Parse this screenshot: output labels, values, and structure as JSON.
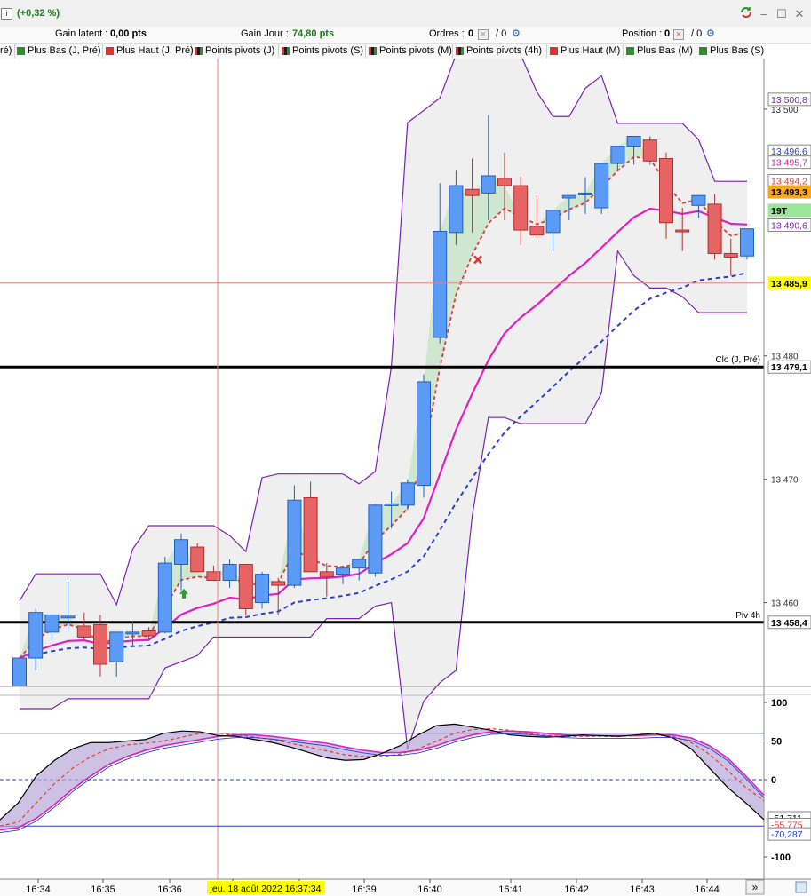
{
  "titlebar": {
    "change_pct": "(+0,32 %)",
    "info_glyph": "i"
  },
  "status": {
    "gain_latent_label": "Gain latent :",
    "gain_latent_value": "0,00 pts",
    "gain_jour_label": "Gain Jour :",
    "gain_jour_value": "74,80 pts",
    "ordres_label": "Ordres :",
    "ordres_value": "0",
    "ordres_slash": "/ 0",
    "position_label": "Position :",
    "position_value": "0",
    "position_slash": "/ 0"
  },
  "legend": [
    {
      "label": "ré)",
      "color": "none"
    },
    {
      "label": "Plus Bas (J, Pré)",
      "color": "#2e8b2e"
    },
    {
      "label": "Plus Haut (J, Pré)",
      "color": "#e03030"
    },
    {
      "label": "Points pivots (J)",
      "color": "#1a1a1a"
    },
    {
      "label": "Points pivots (S)",
      "color": "#1a1a1a"
    },
    {
      "label": "Points pivots (M)",
      "color": "#1a1a1a"
    },
    {
      "label": "Points pivots (4h)",
      "color": "#1a1a1a"
    },
    {
      "label": "Plus Haut (M)",
      "color": "#e03030"
    },
    {
      "label": "Plus Bas (M)",
      "color": "#2e8b2e"
    },
    {
      "label": "Plus Bas (S)",
      "color": "#2e8b2e"
    }
  ],
  "colors": {
    "bull": "#5b9bf5",
    "bear": "#e86464",
    "ema_fast": "#e03a3a",
    "ema_mid": "#e020c0",
    "ema_slow": "#2a3fd0",
    "bands": "#7a22b8",
    "crosshair": "#e88080"
  },
  "chart_data": [
    {
      "type": "candlestick",
      "x_ticks": [
        "16:34",
        "16:35",
        "16:36",
        "16:37",
        "16:38",
        "16:39",
        "16:40",
        "16:41",
        "16:42",
        "16:43",
        "16:44"
      ],
      "y_ticks": [
        13460,
        13470,
        13480,
        13500
      ],
      "y_tick_labels": [
        "13 460",
        "13 470",
        "13 480",
        "13 500"
      ],
      "ylim": [
        13453.2,
        13504.1
      ],
      "candles": [
        {
          "o": 13453.2,
          "h": 13454.5,
          "l": 13453.2,
          "c": 13455.5
        },
        {
          "o": 13455.5,
          "h": 13459.5,
          "l": 13454.5,
          "c": 13459.2
        },
        {
          "o": 13457.6,
          "h": 13458.5,
          "l": 13457.0,
          "c": 13459.0
        },
        {
          "o": 13458.9,
          "h": 13461.7,
          "l": 13457.6,
          "c": 13458.9
        },
        {
          "o": 13458.1,
          "h": 13459.2,
          "l": 13457.0,
          "c": 13457.2
        },
        {
          "o": 13458.2,
          "h": 13459.0,
          "l": 13454.0,
          "c": 13455.0
        },
        {
          "o": 13455.2,
          "h": 13456.5,
          "l": 13454.0,
          "c": 13457.6
        },
        {
          "o": 13457.6,
          "h": 13458.5,
          "l": 13456.5,
          "c": 13457.6
        },
        {
          "o": 13457.7,
          "h": 13458.0,
          "l": 13457.0,
          "c": 13457.3
        },
        {
          "o": 13457.6,
          "h": 13463.7,
          "l": 13457.5,
          "c": 13463.2
        },
        {
          "o": 13463.1,
          "h": 13465.6,
          "l": 13461.0,
          "c": 13465.1
        },
        {
          "o": 13464.5,
          "h": 13464.8,
          "l": 13462.5,
          "c": 13462.5
        },
        {
          "o": 13462.5,
          "h": 13463.0,
          "l": 13461.8,
          "c": 13461.8
        },
        {
          "o": 13461.8,
          "h": 13463.5,
          "l": 13461.2,
          "c": 13463.1
        },
        {
          "o": 13463.1,
          "h": 13463.1,
          "l": 13459.0,
          "c": 13459.5
        },
        {
          "o": 13460.0,
          "h": 13462.5,
          "l": 13459.5,
          "c": 13462.3
        },
        {
          "o": 13461.7,
          "h": 13462.0,
          "l": 13459.0,
          "c": 13461.4
        },
        {
          "o": 13461.4,
          "h": 13469.5,
          "l": 13461.2,
          "c": 13468.3
        },
        {
          "o": 13468.5,
          "h": 13469.8,
          "l": 13462.8,
          "c": 13462.5
        },
        {
          "o": 13462.5,
          "h": 13463.2,
          "l": 13460.5,
          "c": 13462.1
        },
        {
          "o": 13462.3,
          "h": 13463.0,
          "l": 13461.5,
          "c": 13462.8
        },
        {
          "o": 13462.8,
          "h": 13463.5,
          "l": 13461.8,
          "c": 13463.5
        },
        {
          "o": 13462.4,
          "h": 13468.0,
          "l": 13462.1,
          "c": 13467.9
        },
        {
          "o": 13468.0,
          "h": 13469.0,
          "l": 13466.0,
          "c": 13468.0
        },
        {
          "o": 13467.9,
          "h": 13470.0,
          "l": 13467.5,
          "c": 13469.7
        },
        {
          "o": 13469.5,
          "h": 13478.5,
          "l": 13468.5,
          "c": 13477.9
        },
        {
          "o": 13481.5,
          "h": 13494.0,
          "l": 13481.0,
          "c": 13490.1
        },
        {
          "o": 13490.0,
          "h": 13495.0,
          "l": 13489.0,
          "c": 13493.8
        },
        {
          "o": 13493.5,
          "h": 13496.0,
          "l": 13490.0,
          "c": 13493.0
        },
        {
          "o": 13493.2,
          "h": 13499.5,
          "l": 13491.0,
          "c": 13494.6
        },
        {
          "o": 13494.4,
          "h": 13496.5,
          "l": 13491.0,
          "c": 13493.8
        },
        {
          "o": 13493.8,
          "h": 13494.5,
          "l": 13489.0,
          "c": 13490.2
        },
        {
          "o": 13490.5,
          "h": 13493.0,
          "l": 13489.5,
          "c": 13489.8
        },
        {
          "o": 13490.0,
          "h": 13491.8,
          "l": 13488.5,
          "c": 13491.8
        },
        {
          "o": 13492.8,
          "h": 13493.0,
          "l": 13491.0,
          "c": 13493.0
        },
        {
          "o": 13493.2,
          "h": 13494.5,
          "l": 13491.5,
          "c": 13493.2
        },
        {
          "o": 13492.0,
          "h": 13494.5,
          "l": 13491.5,
          "c": 13495.6
        },
        {
          "o": 13495.6,
          "h": 13496.8,
          "l": 13495.0,
          "c": 13497.0
        },
        {
          "o": 13497.0,
          "h": 13497.8,
          "l": 13495.5,
          "c": 13497.8
        },
        {
          "o": 13497.5,
          "h": 13497.8,
          "l": 13495.5,
          "c": 13495.8
        },
        {
          "o": 13496.0,
          "h": 13496.5,
          "l": 13489.5,
          "c": 13490.8
        },
        {
          "o": 13490.2,
          "h": 13492.0,
          "l": 13488.5,
          "c": 13490.1
        },
        {
          "o": 13492.2,
          "h": 13493.0,
          "l": 13491.2,
          "c": 13493.0
        },
        {
          "o": 13492.3,
          "h": 13493.1,
          "l": 13487.8,
          "c": 13488.3
        },
        {
          "o": 13488.3,
          "h": 13489.5,
          "l": 13486.5,
          "c": 13488.0
        },
        {
          "o": 13488.1,
          "h": 13490.0,
          "l": 13487.8,
          "c": 13490.3
        }
      ],
      "price_labels": [
        {
          "text": "13 500,8",
          "value": 13500.8,
          "color": "#7a22b8",
          "bg": "#ffffff"
        },
        {
          "text": "13 496,6",
          "value": 13496.6,
          "color": "#2a3fd0",
          "bg": "#ffffff"
        },
        {
          "text": "13 495,7",
          "value": 13495.7,
          "color": "#d420b0",
          "bg": "#ffffff"
        },
        {
          "text": "13 494,2",
          "value": 13494.2,
          "color": "#e03a3a",
          "bg": "#ffffff"
        },
        {
          "text": "13 493,3",
          "value": 13493.3,
          "color": "#000000",
          "bg": "#f5a623"
        },
        {
          "text": "19T",
          "value": 13491.8,
          "color": "#000000",
          "bg": "#9be59b"
        },
        {
          "text": "13 490,6",
          "value": 13490.6,
          "color": "#7a22b8",
          "bg": "#ffffff"
        },
        {
          "text": "13 485,9",
          "value": 13485.9,
          "color": "#000000",
          "bg": "#ffff00"
        },
        {
          "text": "13 479,1",
          "value": 13479.1,
          "color": "#000000",
          "bg": "#ffffff"
        },
        {
          "text": "13 458,4",
          "value": 13458.4,
          "color": "#000000",
          "bg": "#ffffff"
        }
      ],
      "levels": [
        {
          "name": "Clo (J, Pré)",
          "value": 13479.1
        },
        {
          "name": "Piv 4h",
          "value": 13458.4
        }
      ],
      "crosshair_value": 13485.9,
      "crosshair_label": "jeu. 18 août 2022 16:37:34"
    },
    {
      "type": "line",
      "name": "oscillator",
      "ylim": [
        -100,
        100
      ],
      "y_ticks": [
        100,
        50,
        0,
        -100
      ],
      "reference_lines": [
        60,
        -60
      ],
      "value_labels": [
        {
          "text": "-51,711",
          "value": -51.711,
          "color": "#000000"
        },
        {
          "text": "-55,775",
          "value": -55.775,
          "color": "#e03a3a"
        },
        {
          "text": "-70,287",
          "value": -70.287,
          "color": "#2a3fd0"
        }
      ]
    }
  ]
}
